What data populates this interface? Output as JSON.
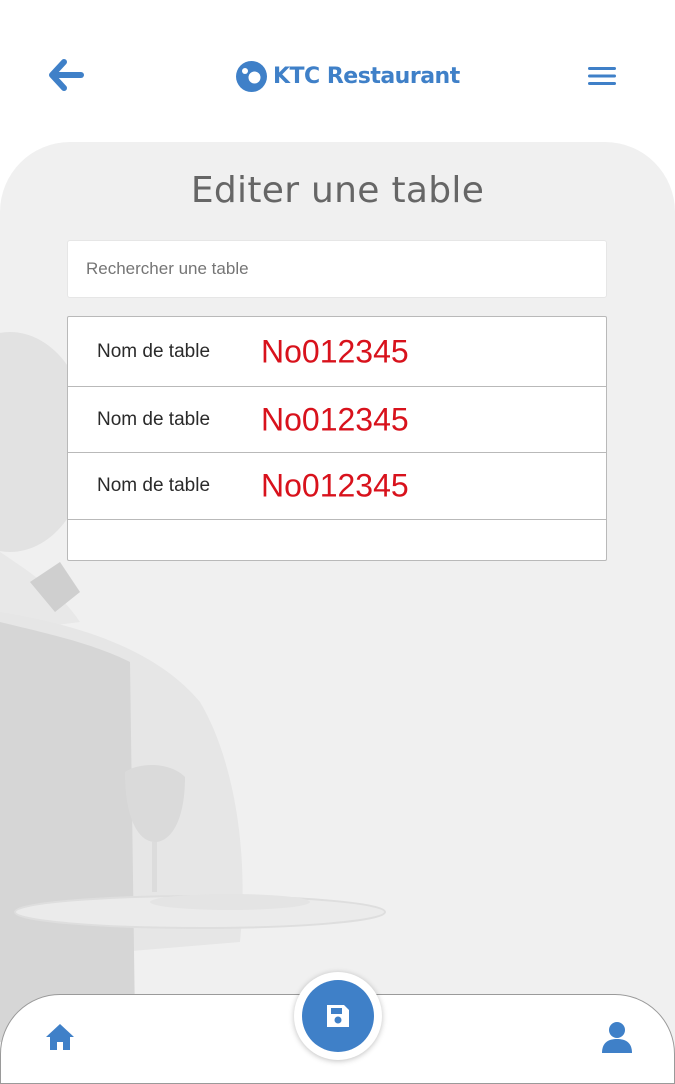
{
  "header": {
    "app_name": "KTC Restaurant",
    "back_icon": "arrow-left-icon",
    "menu_icon": "hamburger-menu-icon",
    "logo_icon": "logo-icon"
  },
  "main": {
    "title": "Editer une table",
    "search": {
      "placeholder": "Rechercher une table",
      "value": ""
    },
    "tables": [
      {
        "label": "Nom de table",
        "value": "No012345"
      },
      {
        "label": "Nom de table",
        "value": "No012345"
      },
      {
        "label": "Nom de table",
        "value": "No012345"
      }
    ]
  },
  "bottom_nav": {
    "home_icon": "home-icon",
    "save_icon": "save-icon",
    "user_icon": "user-icon"
  },
  "colors": {
    "accent": "#3f80c8",
    "value_red": "#d8121c",
    "panel_bg": "#f0f0f0",
    "title_gray": "#666666"
  }
}
